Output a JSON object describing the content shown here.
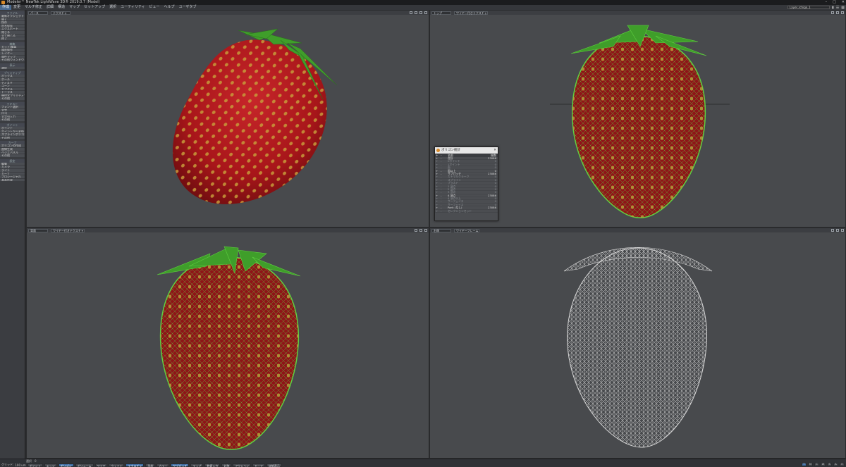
{
  "window": {
    "title": "Modeler™ NewTek LightWave 3D® 2019.0.7 (Model)"
  },
  "menubar": {
    "items": [
      "作成",
      "変更",
      "マルチ修正",
      "詳細",
      "構造",
      "マップ",
      "セットアップ",
      "選択",
      "ユーティリティ",
      "ビュー",
      "ヘルプ",
      "ユーザタブ"
    ],
    "layer_select": "Layer_Ichigo_1"
  },
  "sidebar": {
    "sections": [
      {
        "header": "ファイル",
        "items": [
          "最新オブジェクト",
          "開く",
          "保存",
          "別名保存",
          "エクスポート",
          "閉じる",
          "全て閉じる",
          "終了"
        ]
      },
      {
        "header": "編集",
        "items": [
          "カット/複製",
          "履歴操作",
          "レイヤー",
          "属性マップ",
          "その他ウィンドウ"
        ]
      },
      {
        "header": "表示",
        "items": [
          "選択"
        ]
      },
      {
        "header": "プリミティブ",
        "items": [
          "ボックス",
          "ボール",
          "ディスク",
          "コーン",
          "カプセル",
          "トーラス",
          "幾何学プリミティブ",
          "その他"
        ]
      },
      {
        "header": "テキスト",
        "items": [
          "フォント選択",
          "文字",
          "ロゴ",
          "文字列入力",
          "その他"
        ]
      },
      {
        "header": "ポイント",
        "items": [
          "ポイント",
          "ポイントから変換",
          "スプラインポリゴン",
          "その他"
        ]
      },
      {
        "header": "カーブ",
        "items": [
          "ポリゴンの作成",
          "曲線生成",
          "ベジエパネル",
          "その他"
        ]
      },
      {
        "header": "設定",
        "items": [
          "編集",
          "カメラ",
          "ライト",
          "カーブ",
          "プロシージャル",
          "基本作成"
        ]
      }
    ]
  },
  "viewports": [
    {
      "id": "tl",
      "view": "パース",
      "mode": "テクスチャ",
      "show_mode": true
    },
    {
      "id": "tr",
      "view": "トップ",
      "mode": "ワイヤー付きテクスチャ",
      "show_mode": true
    },
    {
      "id": "bl",
      "view": "背面",
      "mode": "ワイヤー付きテクスチャ",
      "show_mode": true
    },
    {
      "id": "br",
      "view": "右側",
      "mode": "ワイヤーフレーム",
      "show_mode": true
    }
  ],
  "stats_panel": {
    "title": "ポリゴン統計",
    "col_name": "名前",
    "col_count": "総数",
    "rows": [
      {
        "plus": "+",
        "minus": "-",
        "label": "合計",
        "count": "23086",
        "dim": false
      },
      {
        "plus": "+",
        "minus": "-",
        "label": "0ポイント",
        "count": "0",
        "dim": true
      },
      {
        "plus": "+",
        "minus": "-",
        "label": "1ポイント",
        "count": "0",
        "dim": true
      },
      {
        "plus": "+",
        "minus": "-",
        "label": "面",
        "count": "0",
        "dim": true
      },
      {
        "plus": "+",
        "minus": "-",
        "label": "面以上",
        "count": "0",
        "dim": false
      },
      {
        "plus": "+",
        "minus": "-",
        "label": "サブパッチ",
        "count": "23086",
        "dim": false
      },
      {
        "plus": "+",
        "minus": "-",
        "label": "カトマルクラーク",
        "count": "0",
        "dim": true
      },
      {
        "plus": "+",
        "minus": "-",
        "label": "スプライン",
        "count": "0",
        "dim": true
      },
      {
        "plus": "+",
        "minus": "-",
        "label": "ブラスト",
        "count": "0",
        "dim": true
      },
      {
        "plus": "+",
        "minus": "-",
        "label": "1 頂点",
        "count": "0",
        "dim": true
      },
      {
        "plus": "+",
        "minus": "-",
        "label": "2 頂点",
        "count": "0",
        "dim": true
      },
      {
        "plus": "+",
        "minus": "-",
        "label": "3 頂点",
        "count": "0",
        "dim": true
      },
      {
        "plus": "+",
        "minus": "-",
        "label": "4 頂点",
        "count": "23086",
        "dim": false
      },
      {
        "plus": "+",
        "minus": "-",
        "label": "4 頂点以上",
        "count": "0",
        "dim": true
      },
      {
        "plus": "+",
        "minus": "-",
        "label": "サーフェイス",
        "count": "0",
        "dim": true
      },
      {
        "plus": "+",
        "minus": "-",
        "label": "サーフェイス",
        "count": "0",
        "dim": true
      },
      {
        "plus": "+",
        "minus": "-",
        "label": "Part: (なし)",
        "count": "23086",
        "dim": false
      },
      {
        "plus": "+",
        "minus": "-",
        "label": "セレクションセット",
        "count": "",
        "dim": true
      }
    ]
  },
  "statusbar": {
    "selection_label": "選択",
    "selection_value": "0",
    "grid_label": "グリッド:",
    "grid_value": "100 um",
    "tools": [
      {
        "label": "ポイント",
        "active": false
      },
      {
        "label": "エッジ",
        "active": false
      },
      {
        "label": "ポリゴン",
        "active": true
      },
      {
        "label": "ボリューム",
        "active": false
      },
      {
        "label": "ワイヤ",
        "active": false
      },
      {
        "label": "ウェイト",
        "active": false
      },
      {
        "label": "テクスチャ",
        "active": true
      },
      {
        "label": "形状",
        "active": false
      },
      {
        "label": "カラー",
        "active": false
      },
      {
        "label": "サブパッチ",
        "active": true
      },
      {
        "label": "マップ",
        "active": false
      },
      {
        "label": "数値入力",
        "active": false
      },
      {
        "label": "対称",
        "active": false
      },
      {
        "label": "アクション",
        "active": false
      },
      {
        "label": "モーフ",
        "active": false
      },
      {
        "label": "詳細表示",
        "active": false
      }
    ],
    "right_tools": [
      "T",
      "M",
      "C",
      "W",
      "S",
      "A",
      "E"
    ]
  },
  "colors": {
    "strawberry_red": "#a8161a",
    "seed": "#c79a3a",
    "leaf_green": "#3f9e2a",
    "wire_green": "#5fd040",
    "wire_white": "#d9d9d9",
    "viewport_bg": "#484a4d",
    "active_tool": "#3f6fa6"
  }
}
